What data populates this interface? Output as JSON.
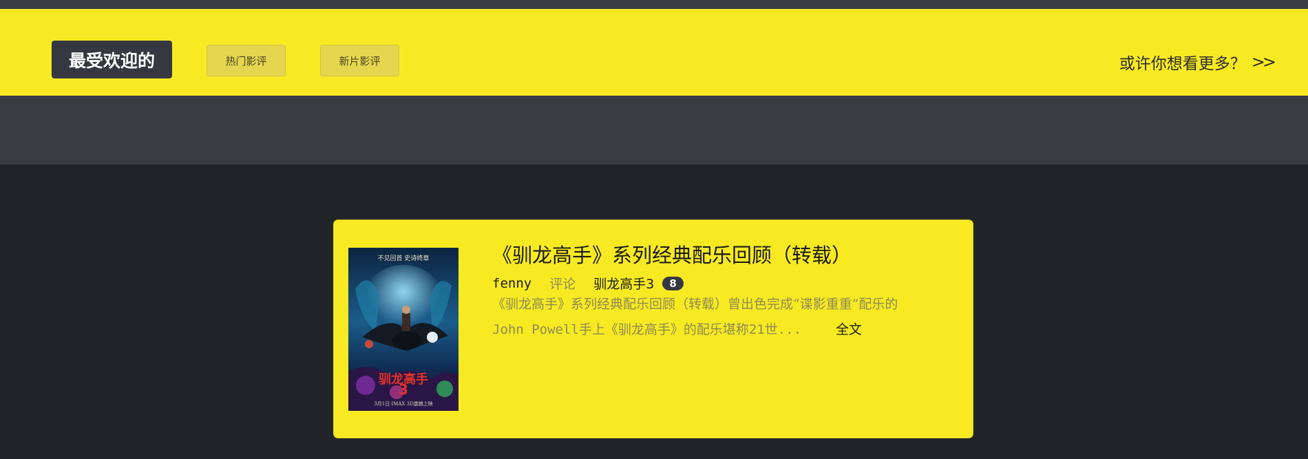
{
  "nav": {
    "tabs": [
      {
        "label": "最受欢迎的",
        "active": true
      },
      {
        "label": "热门影评",
        "active": false
      },
      {
        "label": "新片影评",
        "active": false
      }
    ],
    "more_link": "或许你想看更多？",
    "more_icon": ">>"
  },
  "colors": {
    "accent": "#f8ea22",
    "dark": "#212428",
    "hero": "#383b42",
    "button_dark": "#353840"
  },
  "review": {
    "title": "《驯龙高手》系列经典配乐回顾（转载）",
    "author": "fenny",
    "type": "评论",
    "movie": "驯龙高手3",
    "score": "8",
    "excerpt_line1": "《驯龙高手》系列经典配乐回顾（转载）曾出色完成“谍影重重”配乐的",
    "excerpt_line2": "John Powell手上《驯龙高手》的配乐堪称21世...",
    "full_text_link": "全文",
    "poster": {
      "tagline": "不见回首  史诗终章",
      "title_cn": "驯龙高手",
      "number": "3",
      "date": "3月1日  IMAX 3D震撼上映"
    }
  }
}
